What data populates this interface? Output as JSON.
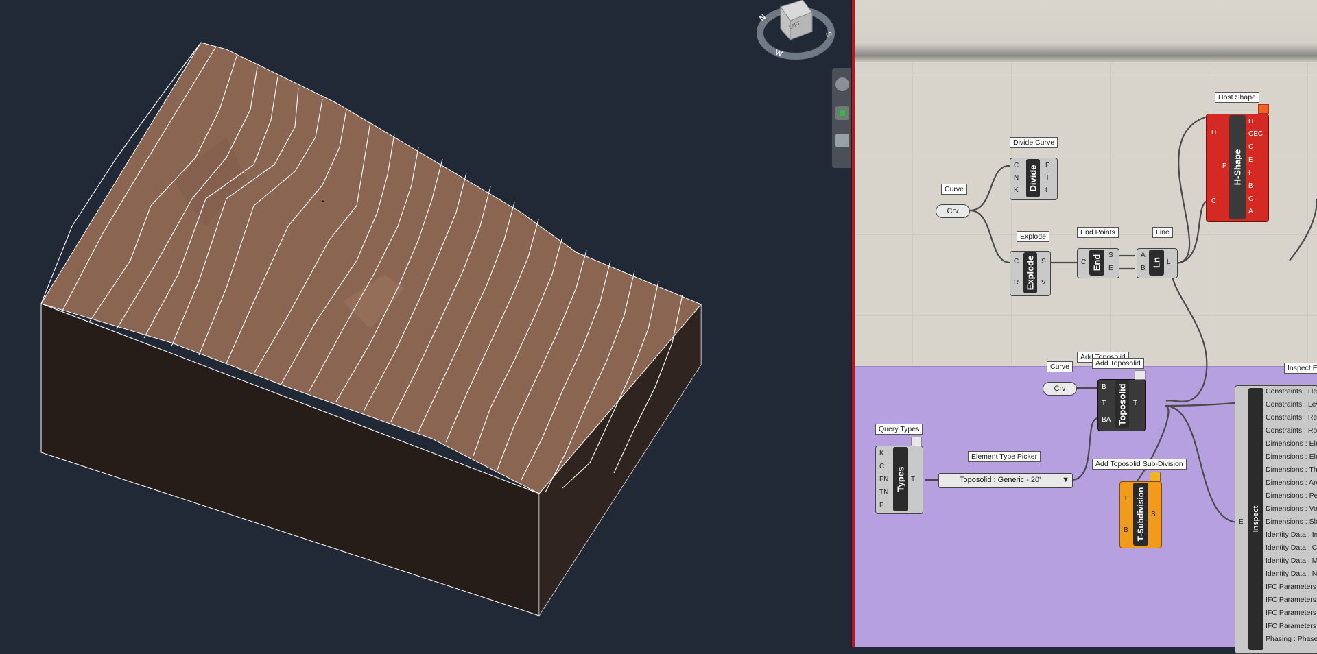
{
  "viewcube": {
    "face_label": "LEFT",
    "compass_labels": [
      "N",
      "W",
      "S"
    ]
  },
  "canvas": {
    "divide_curve": {
      "title": "Divide Curve",
      "name": "Divide",
      "inputs": [
        "C",
        "N",
        "K"
      ],
      "outputs": [
        "P",
        "T",
        "t"
      ]
    },
    "curve_param_1": {
      "title": "Curve",
      "value": "Crv"
    },
    "explode": {
      "title": "Explode",
      "name": "Explode",
      "inputs": [
        "C",
        "R"
      ],
      "outputs": [
        "S",
        "V"
      ]
    },
    "end_points": {
      "title": "End Points",
      "name": "End",
      "inputs": [
        "C"
      ],
      "outputs": [
        "S",
        "E"
      ]
    },
    "line": {
      "title": "Line",
      "name": "Ln",
      "inputs": [
        "A",
        "B"
      ],
      "outputs": [
        "L"
      ]
    },
    "host_shape": {
      "title": "Host Shape",
      "name": "H-Shape",
      "inputs": [
        "H",
        "P",
        "C"
      ],
      "outputs": [
        "H",
        "CEC",
        "C",
        "E",
        "I",
        "B",
        "C",
        "A"
      ]
    },
    "curve_param_2": {
      "title": "Curve",
      "value": "Crv"
    },
    "add_toposolid": {
      "title_back": "Add Toposolid",
      "title": "Add Toposolid",
      "name": "Toposolid",
      "inputs": [
        "B",
        "T",
        "BA"
      ],
      "outputs": [
        "T"
      ]
    },
    "query_types": {
      "title": "Query Types",
      "name": "Types",
      "inputs": [
        "K",
        "C",
        "FN",
        "TN",
        "F"
      ],
      "outputs": [
        "T"
      ]
    },
    "element_type_picker": {
      "title": "Element Type Picker",
      "value": "Toposolid : Generic - 20'"
    },
    "add_subdivision": {
      "title": "Add Toposolid Sub-Division",
      "name": "T-Subdivision",
      "inputs": [
        "T",
        "B"
      ],
      "outputs": [
        "S"
      ]
    },
    "inspect": {
      "title": "Inspect E",
      "name": "Inspect",
      "inputs": [
        "E"
      ],
      "rows": [
        "Constraints : He",
        "Constraints : Lev",
        "Constraints : Rel",
        "Constraints : Roo",
        "Dimensions : Ele",
        "Dimensions : Ele",
        "Dimensions : Thi",
        "Dimensions : Are",
        "Dimensions : Per",
        "Dimensions : Vol",
        "Dimensions : Slo",
        "Identity Data : Im",
        "Identity Data : Co",
        "Identity Data : M",
        "Identity Data : N",
        "IFC Parameters :",
        "IFC Parameters :",
        "IFC Parameters :",
        "IFC Parameters :",
        "Phasing : Phase"
      ]
    }
  },
  "colors": {
    "viewport_bg": "#212836",
    "terrain_top": "#8a6552",
    "terrain_side": "#261d19",
    "contour": "#ffffff",
    "canvas_bg": "#d8d4cc",
    "purple_group": "#b6a0e0",
    "host_shape_red": "#d42a23",
    "subdivision_orange": "#f29a1c",
    "divider_red": "#c0141a"
  }
}
